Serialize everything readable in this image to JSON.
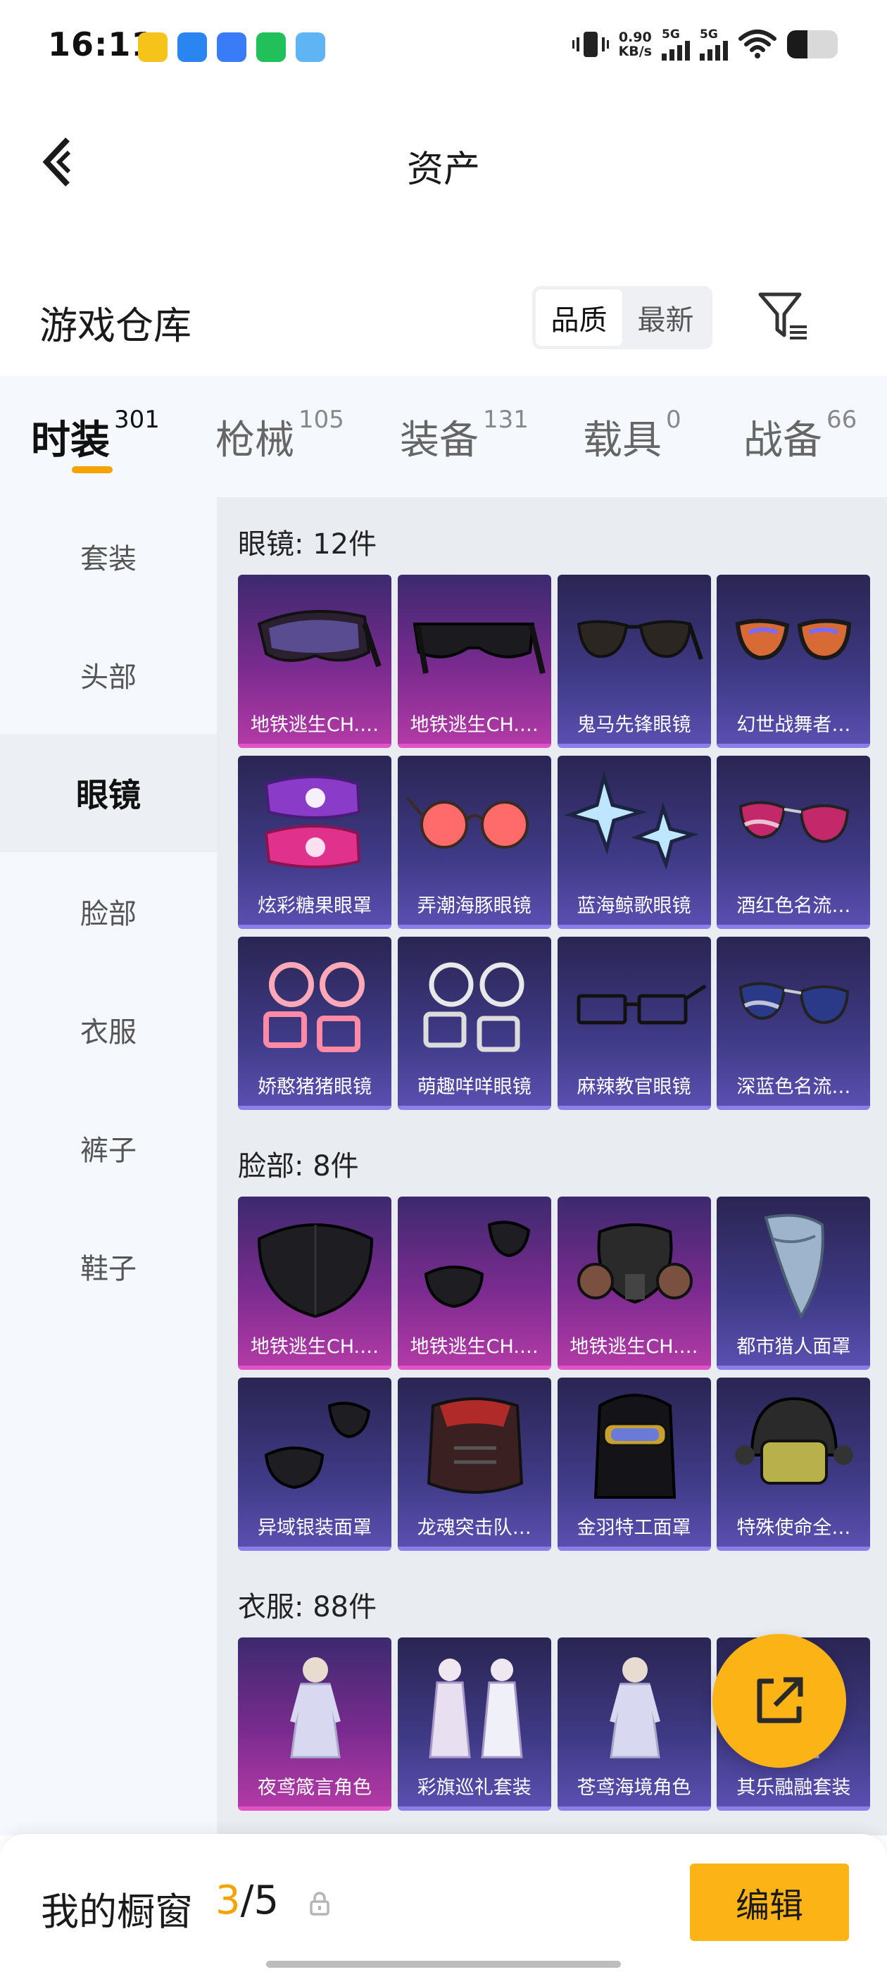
{
  "status_bar": {
    "time": "16:11",
    "apps": [
      {
        "icon": "yellow-app-icon",
        "color": "#f6c31b"
      },
      {
        "icon": "blue-app-icon",
        "color": "#2a85f0"
      },
      {
        "icon": "chat-app-icon",
        "color": "#3a7bf7"
      },
      {
        "icon": "wechat-icon",
        "color": "#22c05a"
      },
      {
        "icon": "photo-app-icon",
        "color": "#5fb4f4"
      }
    ],
    "network_speed": "0.90",
    "network_unit": "KB/s",
    "sim1": "5G",
    "sim2": "5G",
    "battery_percent": 40
  },
  "header": {
    "title": "资产",
    "back_icon": "chevron-left-icon"
  },
  "warehouse": {
    "title": "游戏仓库",
    "sort_options": [
      "品质",
      "最新"
    ],
    "sort_selected": "品质",
    "filter_icon": "filter-icon"
  },
  "tabs": [
    {
      "label": "时装",
      "count": "301",
      "active": true
    },
    {
      "label": "枪械",
      "count": "105",
      "active": false
    },
    {
      "label": "装备",
      "count": "131",
      "active": false
    },
    {
      "label": "载具",
      "count": "0",
      "active": false
    },
    {
      "label": "战备",
      "count": "66",
      "active": false
    }
  ],
  "sidebar": {
    "items": [
      "套装",
      "头部",
      "眼镜",
      "脸部",
      "衣服",
      "裤子",
      "鞋子"
    ],
    "active": "眼镜"
  },
  "sections": [
    {
      "title": "眼镜: 12件",
      "items": [
        {
          "name": "地铁逃生CH.…",
          "rarity": "pink",
          "thumb": "shield-goggles"
        },
        {
          "name": "地铁逃生CH.…",
          "rarity": "pink",
          "thumb": "black-glasses"
        },
        {
          "name": "鬼马先锋眼镜",
          "rarity": "purple",
          "thumb": "sunglasses"
        },
        {
          "name": "幻世战舞者…",
          "rarity": "purple",
          "thumb": "orange-sunglasses"
        },
        {
          "name": "炫彩糖果眼罩",
          "rarity": "purple",
          "thumb": "candy-mask"
        },
        {
          "name": "弄潮海豚眼镜",
          "rarity": "purple",
          "thumb": "round-red"
        },
        {
          "name": "蓝海鲸歌眼镜",
          "rarity": "purple",
          "thumb": "star-glasses"
        },
        {
          "name": "酒红色名流…",
          "rarity": "purple",
          "thumb": "aviator-red"
        },
        {
          "name": "娇憨猪猪眼镜",
          "rarity": "purple",
          "thumb": "pink-frames"
        },
        {
          "name": "萌趣咩咩眼镜",
          "rarity": "purple",
          "thumb": "white-frames"
        },
        {
          "name": "麻辣教官眼镜",
          "rarity": "purple",
          "thumb": "rect-frames"
        },
        {
          "name": "深蓝色名流…",
          "rarity": "purple",
          "thumb": "aviator-blue"
        }
      ]
    },
    {
      "title": "脸部: 8件",
      "items": [
        {
          "name": "地铁逃生CH.…",
          "rarity": "pink",
          "thumb": "mask"
        },
        {
          "name": "地铁逃生CH.…",
          "rarity": "pink",
          "thumb": "mask-parts"
        },
        {
          "name": "地铁逃生CH.…",
          "rarity": "pink",
          "thumb": "gas-mask"
        },
        {
          "name": "都市猎人面罩",
          "rarity": "purple",
          "thumb": "bandana"
        },
        {
          "name": "异域银装面罩",
          "rarity": "purple",
          "thumb": "mask-parts"
        },
        {
          "name": "龙魂突击队…",
          "rarity": "purple",
          "thumb": "red-mask"
        },
        {
          "name": "金羽特工面罩",
          "rarity": "purple",
          "thumb": "balaclava"
        },
        {
          "name": "特殊使命全…",
          "rarity": "purple",
          "thumb": "helmet"
        }
      ]
    },
    {
      "title": "衣服: 88件",
      "items": [
        {
          "name": "夜鸢箴言角色",
          "rarity": "pink",
          "thumb": "character"
        },
        {
          "name": "彩旗巡礼套装",
          "rarity": "purple",
          "thumb": "characters"
        },
        {
          "name": "苍鸢海境角色",
          "rarity": "purple",
          "thumb": "character"
        },
        {
          "name": "其乐融融套装",
          "rarity": "purple",
          "thumb": "character"
        }
      ]
    }
  ],
  "fab": {
    "icon": "share-icon"
  },
  "bottom_bar": {
    "label": "我的橱窗",
    "current": "3",
    "total": "/5",
    "lock_icon": "lock-icon",
    "edit_label": "编辑"
  },
  "colors": {
    "accent": "#fbb315",
    "pink_card": "#b23aa6",
    "purple_card": "#5a4fb0"
  }
}
